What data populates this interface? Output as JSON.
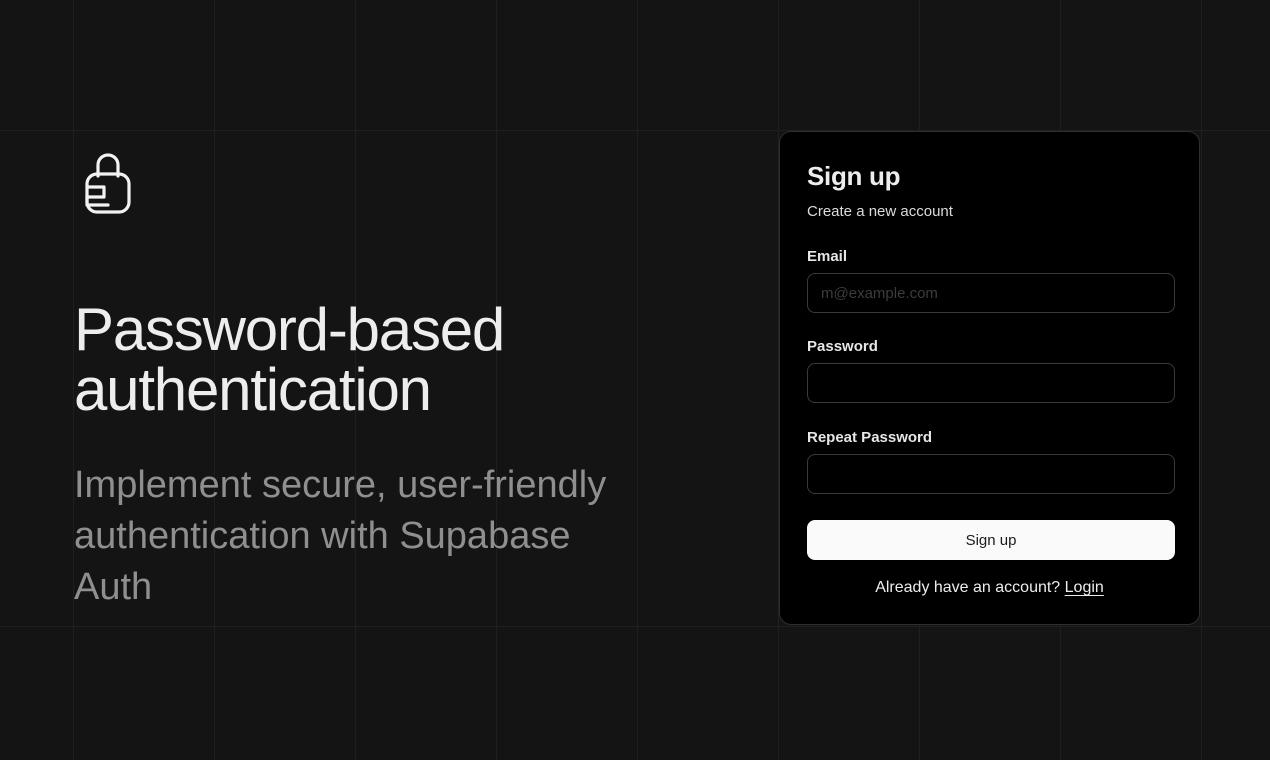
{
  "hero": {
    "logo_icon": "padlock-icon",
    "title": "Password-based authentication",
    "subtitle": "Implement secure, user-friendly authentication with Supabase Auth"
  },
  "signup_card": {
    "title": "Sign up",
    "description": "Create a new account",
    "email": {
      "label": "Email",
      "placeholder": "m@example.com",
      "value": ""
    },
    "password": {
      "label": "Password",
      "value": ""
    },
    "repeat_password": {
      "label": "Repeat Password",
      "value": ""
    },
    "submit_label": "Sign up",
    "login_prompt": "Already have an account?",
    "login_link": "Login"
  },
  "colors": {
    "background": "#141414",
    "card_background": "#000000",
    "button_background": "#fafafa",
    "muted_text": "#8f8f8f"
  }
}
